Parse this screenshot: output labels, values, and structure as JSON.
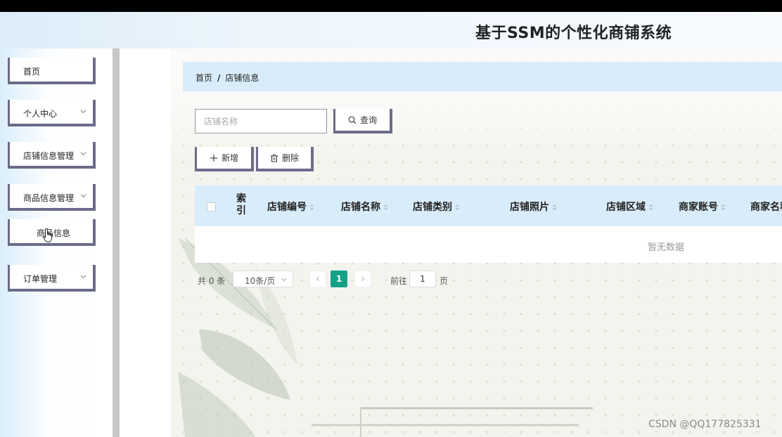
{
  "app": {
    "title": "基于SSM的个性化商铺系统"
  },
  "sidebar": {
    "items": [
      {
        "label": "首页"
      },
      {
        "label": "个人中心"
      },
      {
        "label": "店铺信息管理"
      },
      {
        "label": "商品信息管理"
      },
      {
        "label": "商品信息"
      },
      {
        "label": "订单管理"
      }
    ]
  },
  "breadcrumb": {
    "home": "首页",
    "separator": "/",
    "current": "店铺信息"
  },
  "search": {
    "placeholder": "店铺名称",
    "value": "",
    "button_label": "查询"
  },
  "toolbar": {
    "add_label": "新增",
    "delete_label": "删除"
  },
  "table": {
    "columns": [
      "索引",
      "店铺编号",
      "店铺名称",
      "店铺类别",
      "店铺照片",
      "店铺区域",
      "商家账号",
      "商家名称"
    ],
    "rows": [],
    "empty_text": "暂无数据"
  },
  "pagination": {
    "total_text": "共 0 条",
    "page_size": "10条/页",
    "current_page": "1",
    "goto_label": "前往",
    "goto_value": "1",
    "page_unit": "页"
  },
  "watermark": "CSDN @QQ177825331",
  "colors": {
    "accent": "#14a286",
    "button_border": "#6b6b8a",
    "header_bg": "#d8ecf9"
  }
}
